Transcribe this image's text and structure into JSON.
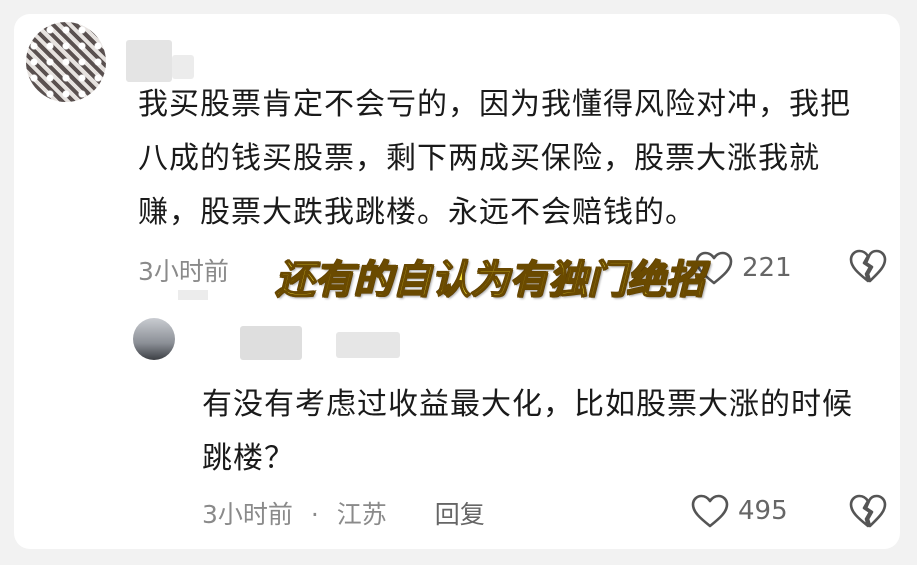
{
  "comments": [
    {
      "text": "我买股票肯定不会亏的，因为我懂得风险对冲，我把八成的钱买股票，剩下两成买保险，股票大涨我就赚，股票大跌我跳楼。永远不会赔钱的。",
      "time": "3小时前",
      "location": "",
      "reply_label": "",
      "likes": "221"
    },
    {
      "text": "有没有考虑过收益最大化，比如股票大涨的时候跳楼？",
      "time": "3小时前",
      "location": "江苏",
      "reply_label": "回复",
      "likes": "495"
    }
  ],
  "overlay_caption": "还有的自认为有独门绝招",
  "colors": {
    "overlay_text": "#ffec3a",
    "meta_text": "#8a8a8a",
    "body_text": "#1a1a1a"
  }
}
